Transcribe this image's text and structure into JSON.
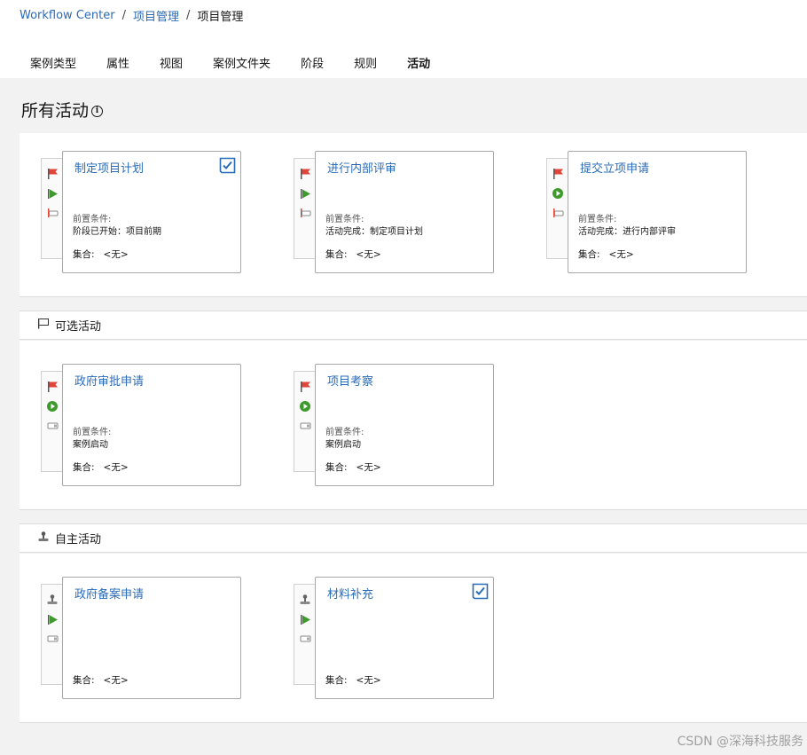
{
  "breadcrumb": {
    "root": "Workflow Center",
    "parent": "项目管理",
    "current": "项目管理",
    "sep": "/"
  },
  "tabs": [
    {
      "label": "案例类型"
    },
    {
      "label": "属性"
    },
    {
      "label": "视图"
    },
    {
      "label": "案例文件夹"
    },
    {
      "label": "阶段"
    },
    {
      "label": "规则"
    },
    {
      "label": "活动",
      "active": true
    }
  ],
  "page_title": "所有活动",
  "info_icon": "i",
  "labels": {
    "precondition": "前置条件:",
    "collection": "集合:",
    "none": "<无>"
  },
  "required": [
    {
      "title": "制定项目计划",
      "checked": true,
      "condition": "阶段已开始：项目前期"
    },
    {
      "title": "进行内部评审",
      "checked": false,
      "condition": "活动完成：制定项目计划"
    },
    {
      "title": "提交立项申请",
      "checked": false,
      "condition": "活动完成：进行内部评审"
    }
  ],
  "optional": {
    "header": "可选活动",
    "cards": [
      {
        "title": "政府审批申请",
        "condition": "案例启动"
      },
      {
        "title": "项目考察",
        "condition": "案例启动"
      }
    ]
  },
  "discretionary": {
    "header": "自主活动",
    "cards": [
      {
        "title": "政府备案申请",
        "checked": false
      },
      {
        "title": "材料补充",
        "checked": true
      }
    ]
  },
  "watermark": "CSDN @深海科技服务",
  "colors": {
    "accent": "#2a6bb8",
    "flag": "#e0453a",
    "play": "#3f9a2e"
  },
  "icons": [
    "flag-icon",
    "play-icon",
    "stop-icon",
    "flag-outline-icon",
    "stamp-icon",
    "checkmark-icon",
    "info-icon"
  ]
}
